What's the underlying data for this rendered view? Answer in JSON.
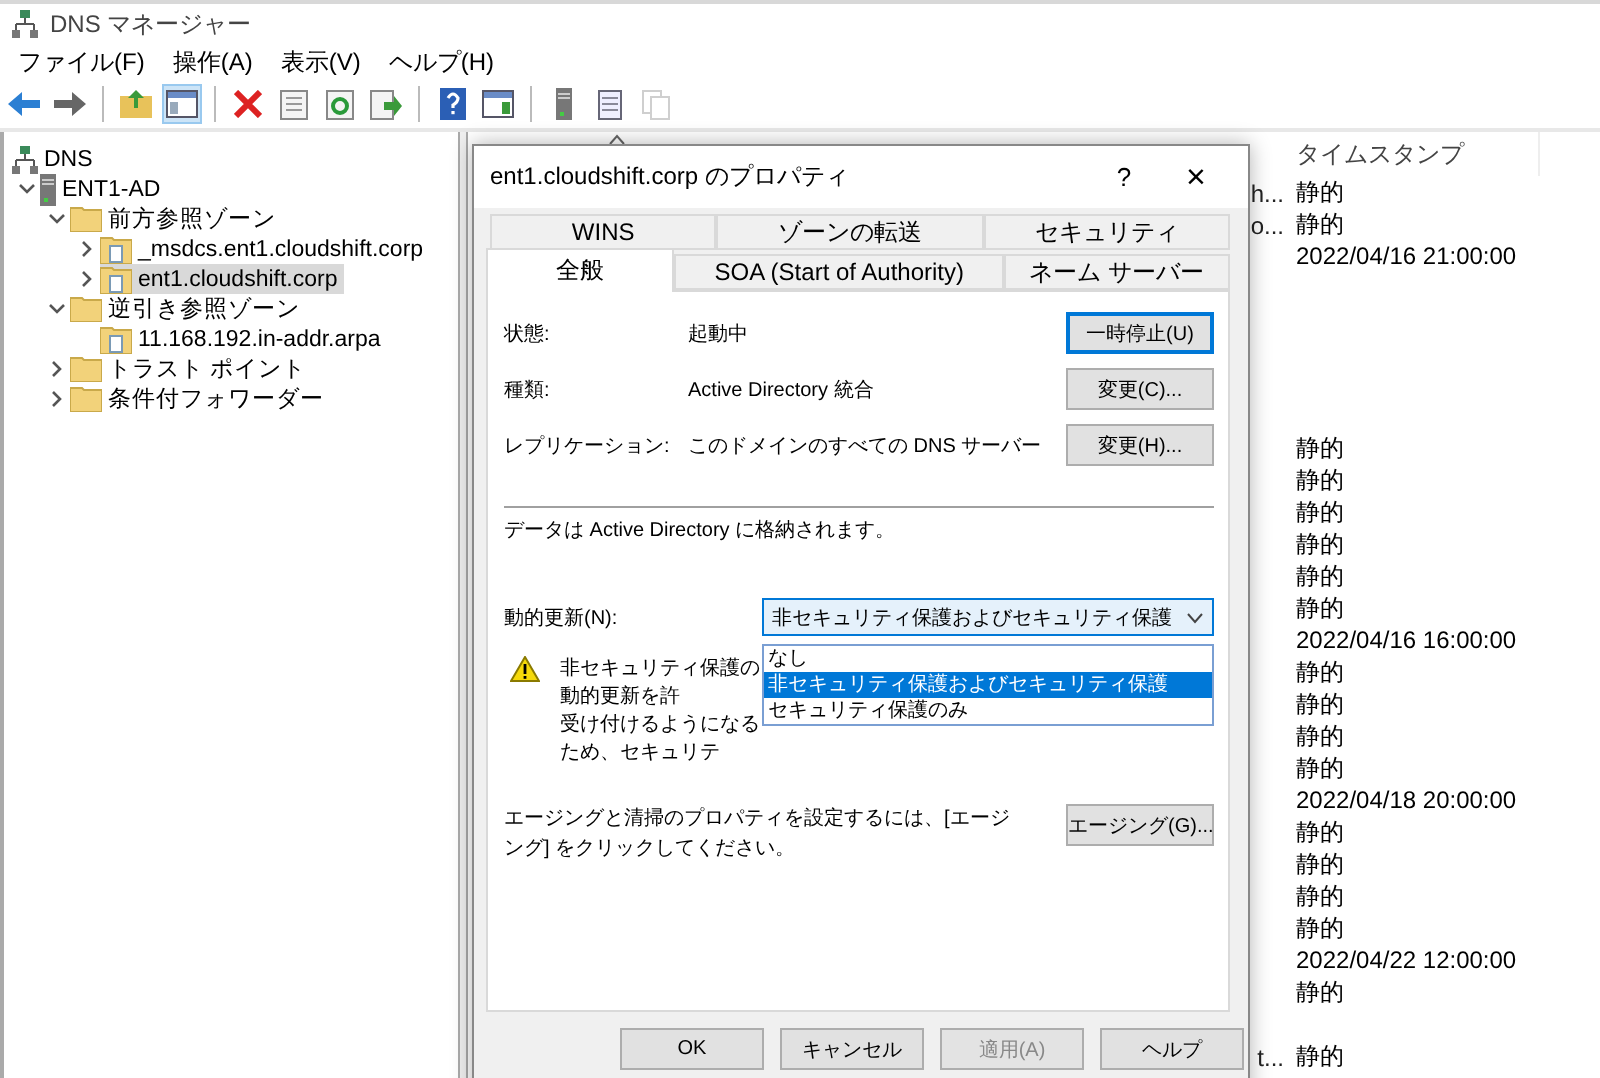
{
  "window": {
    "title": "DNS マネージャー"
  },
  "menu": [
    {
      "label": "ファイル(F)"
    },
    {
      "label": "操作(A)"
    },
    {
      "label": "表示(V)"
    },
    {
      "label": "ヘルプ(H)"
    }
  ],
  "toolbar": [
    {
      "kind": "back",
      "selected": false,
      "disabled": false
    },
    {
      "kind": "forward",
      "selected": false,
      "disabled": false
    },
    {
      "kind": "sep"
    },
    {
      "kind": "up",
      "selected": false,
      "disabled": false
    },
    {
      "kind": "pane",
      "selected": true,
      "disabled": false
    },
    {
      "kind": "sep"
    },
    {
      "kind": "delete",
      "selected": false,
      "disabled": false
    },
    {
      "kind": "properties",
      "selected": false,
      "disabled": false
    },
    {
      "kind": "refresh",
      "selected": false,
      "disabled": false
    },
    {
      "kind": "export",
      "selected": false,
      "disabled": false
    },
    {
      "kind": "sep"
    },
    {
      "kind": "help",
      "selected": false,
      "disabled": false
    },
    {
      "kind": "action",
      "selected": false,
      "disabled": false
    },
    {
      "kind": "sep"
    },
    {
      "kind": "server",
      "selected": false,
      "disabled": false
    },
    {
      "kind": "list",
      "selected": false,
      "disabled": false
    },
    {
      "kind": "copy",
      "selected": false,
      "disabled": true
    }
  ],
  "tree": [
    {
      "label": "DNS",
      "kind": "dns",
      "selected": false,
      "children": [
        {
          "label": "ENT1-AD",
          "kind": "server",
          "selected": false,
          "expanded": true,
          "children": [
            {
              "label": "前方参照ゾーン",
              "kind": "folder",
              "selected": false,
              "expanded": true,
              "children": [
                {
                  "label": "_msdcs.ent1.cloudshift.corp",
                  "kind": "zone",
                  "selected": false,
                  "expanded": false
                },
                {
                  "label": "ent1.cloudshift.corp",
                  "kind": "zone",
                  "selected": true,
                  "expanded": false
                }
              ]
            },
            {
              "label": "逆引き参照ゾーン",
              "kind": "folder",
              "selected": false,
              "expanded": true,
              "children": [
                {
                  "label": "11.168.192.in-addr.arpa",
                  "kind": "zone",
                  "selected": false
                }
              ]
            },
            {
              "label": "トラスト ポイント",
              "kind": "folder",
              "selected": false,
              "expanded": false
            },
            {
              "label": "条件付フォワーダー",
              "kind": "folder",
              "selected": false,
              "expanded": false
            }
          ]
        }
      ]
    }
  ],
  "list": {
    "columns": [
      {
        "label": "タイムスタンプ"
      }
    ],
    "rows": [
      {
        "column_2": "h...",
        "timestamp": "静的"
      },
      {
        "column_2": "o...",
        "timestamp": "静的"
      },
      {
        "timestamp": "2022/04/16 21:00:00"
      },
      {},
      {},
      {},
      {},
      {},
      {
        "timestamp": "静的"
      },
      {
        "timestamp": "静的"
      },
      {
        "timestamp": "静的"
      },
      {
        "timestamp": "静的"
      },
      {
        "timestamp": "静的"
      },
      {
        "timestamp": "静的"
      },
      {
        "timestamp": "2022/04/16 16:00:00"
      },
      {
        "timestamp": "静的"
      },
      {
        "timestamp": "静的"
      },
      {
        "timestamp": "静的"
      },
      {
        "timestamp": "静的"
      },
      {
        "timestamp": "2022/04/18 20:00:00"
      },
      {
        "timestamp": "静的"
      },
      {
        "timestamp": "静的"
      },
      {
        "timestamp": "静的"
      },
      {
        "timestamp": "静的"
      },
      {
        "timestamp": "2022/04/22 12:00:00"
      },
      {
        "timestamp": "静的"
      },
      {},
      {
        "column_2": "t...",
        "timestamp": "静的"
      }
    ]
  },
  "dialog": {
    "title": "ent1.cloudshift.corp のプロパティ",
    "help": "?",
    "close": "×",
    "tab_rows": [
      {
        "tabs": [
          {
            "label": "WINS",
            "selected": false
          },
          {
            "label": "ゾーンの転送",
            "selected": false
          },
          {
            "label": "セキュリティ",
            "selected": false
          }
        ]
      },
      {
        "tabs": [
          {
            "label": "全般",
            "selected": true
          },
          {
            "label": "SOA (Start of Authority)",
            "selected": false
          },
          {
            "label": "ネーム サーバー",
            "selected": false
          }
        ]
      }
    ],
    "fields": [
      {
        "label": "状態:",
        "value": "起動中",
        "button": "一時停止(U)",
        "focused": true
      },
      {
        "label": "種類:",
        "value": "Active Directory 統合",
        "button": "変更(C)...",
        "focused": false
      },
      {
        "label": "レプリケーション:",
        "value": "このドメインのすべての DNS サーバー",
        "button": "変更(H)...",
        "focused": false
      }
    ],
    "storage_note": "データは Active Directory に格納されます。",
    "dynamic_update": {
      "label": "動的更新(N):",
      "value": "非セキュリティ保護およびセキュリティ保護",
      "expanded": true,
      "options": [
        {
          "label": "なし",
          "selected": false
        },
        {
          "label": "非セキュリティ保護およびセキュリティ保護",
          "selected": true
        },
        {
          "label": "セキュリティ保護のみ",
          "selected": false
        }
      ]
    },
    "warning": {
      "lines": [
        "非セキュリティ保護の動的更新を許",
        "受け付けるようになるため、セキュリテ"
      ]
    },
    "aging": {
      "text": "エージングと清掃のプロパティを設定するには、[エージング] をクリックしてください。",
      "button": "エージング(G)..."
    },
    "buttons": [
      {
        "label": "OK",
        "disabled": false
      },
      {
        "label": "キャンセル",
        "disabled": false
      },
      {
        "label": "適用(A)",
        "disabled": true
      },
      {
        "label": "ヘルプ",
        "disabled": false
      }
    ]
  }
}
